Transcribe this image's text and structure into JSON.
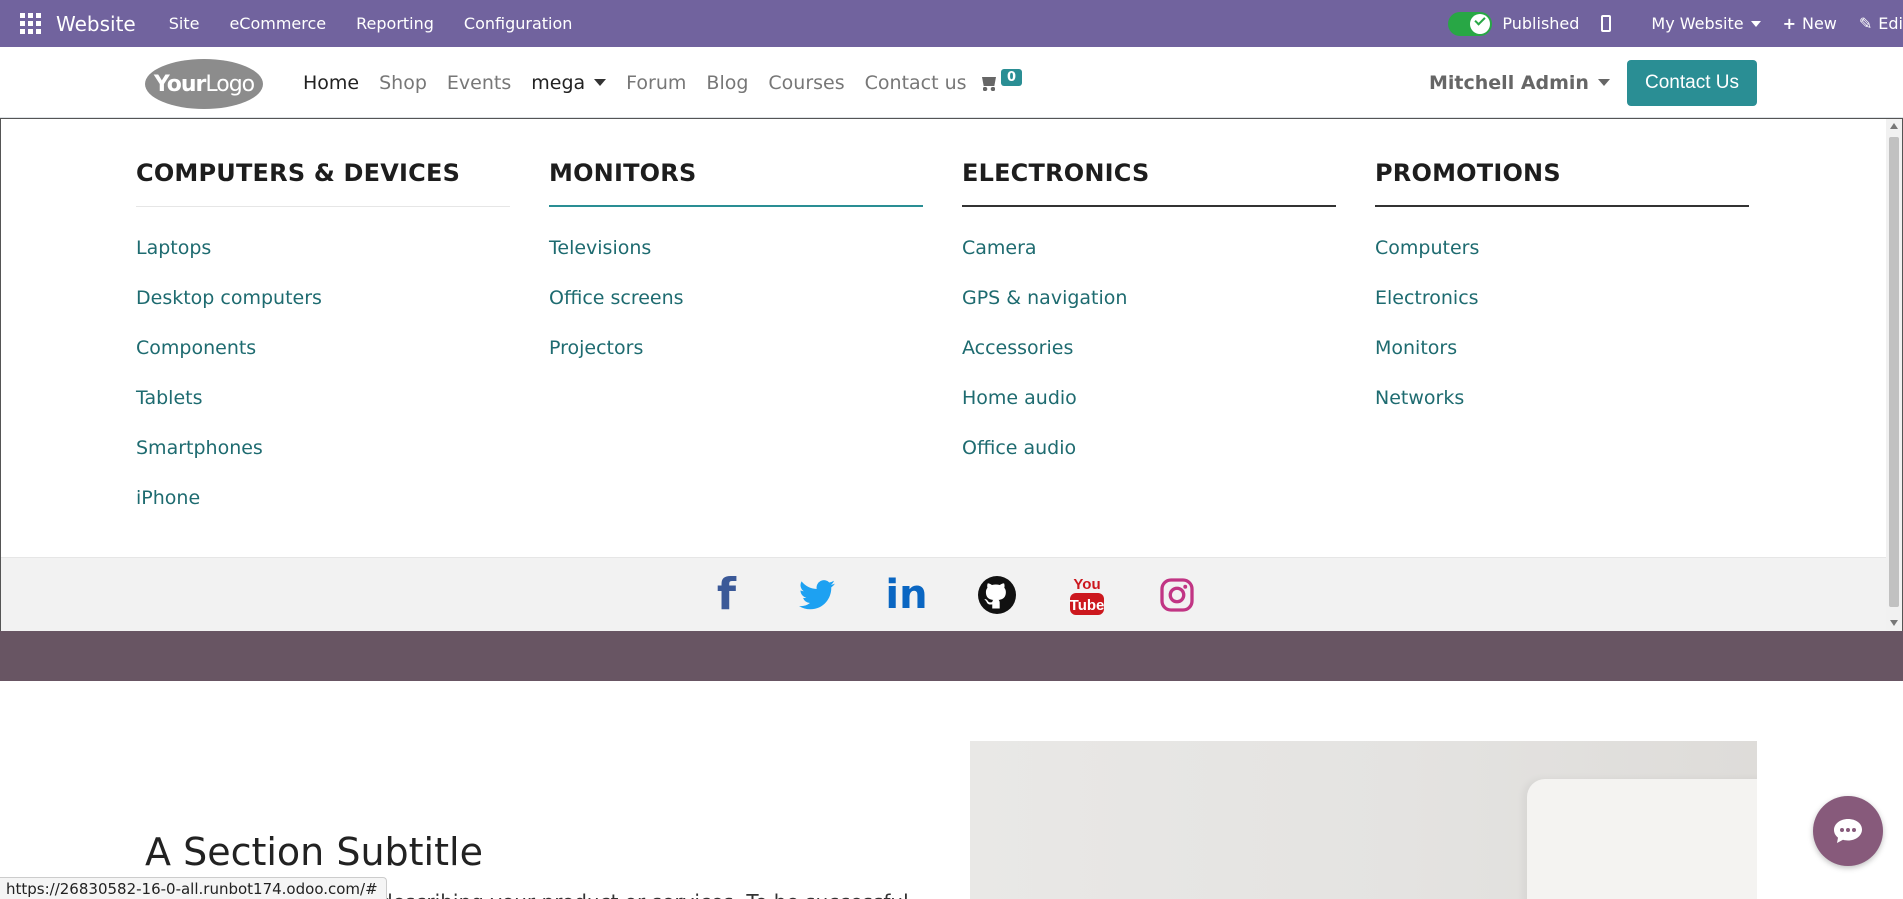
{
  "adminbar": {
    "app_name": "Website",
    "menu": [
      "Site",
      "eCommerce",
      "Reporting",
      "Configuration"
    ],
    "published_label": "Published",
    "website_selector": "My Website",
    "new_label": "New",
    "edit_label": "Edi"
  },
  "header": {
    "logo_text_bold": "Your",
    "logo_text": "Logo",
    "nav": [
      "Home",
      "Shop",
      "Events",
      "mega",
      "Forum",
      "Blog",
      "Courses",
      "Contact us"
    ],
    "cart_count": "0",
    "user_name": "Mitchell Admin",
    "contact_button": "Contact Us"
  },
  "mega_menu": {
    "columns": [
      {
        "title": "COMPUTERS & DEVICES",
        "items": [
          "Laptops",
          "Desktop computers",
          "Components",
          "Tablets",
          "Smartphones",
          "iPhone"
        ]
      },
      {
        "title": "MONITORS",
        "items": [
          "Televisions",
          "Office screens",
          "Projectors"
        ]
      },
      {
        "title": "ELECTRONICS",
        "items": [
          "Camera",
          "GPS & navigation",
          "Accessories",
          "Home audio",
          "Office audio"
        ]
      },
      {
        "title": "PROMOTIONS",
        "items": [
          "Computers",
          "Electronics",
          "Monitors",
          "Networks"
        ]
      }
    ],
    "social_icons": [
      "facebook-icon",
      "twitter-icon",
      "linkedin-icon",
      "github-icon",
      "youtube-icon",
      "instagram-icon"
    ]
  },
  "content": {
    "section_subtitle": "A Section Subtitle",
    "body_fragment": "describing your product or services. To be successful"
  },
  "statusbar": {
    "url": "https://26830582-16-0-all.runbot174.odoo.com/#"
  },
  "colors": {
    "adminbar": "#71639e",
    "accent": "#2a8e94",
    "link": "#1e6b70",
    "band": "#685563",
    "chat": "#875a7b"
  }
}
